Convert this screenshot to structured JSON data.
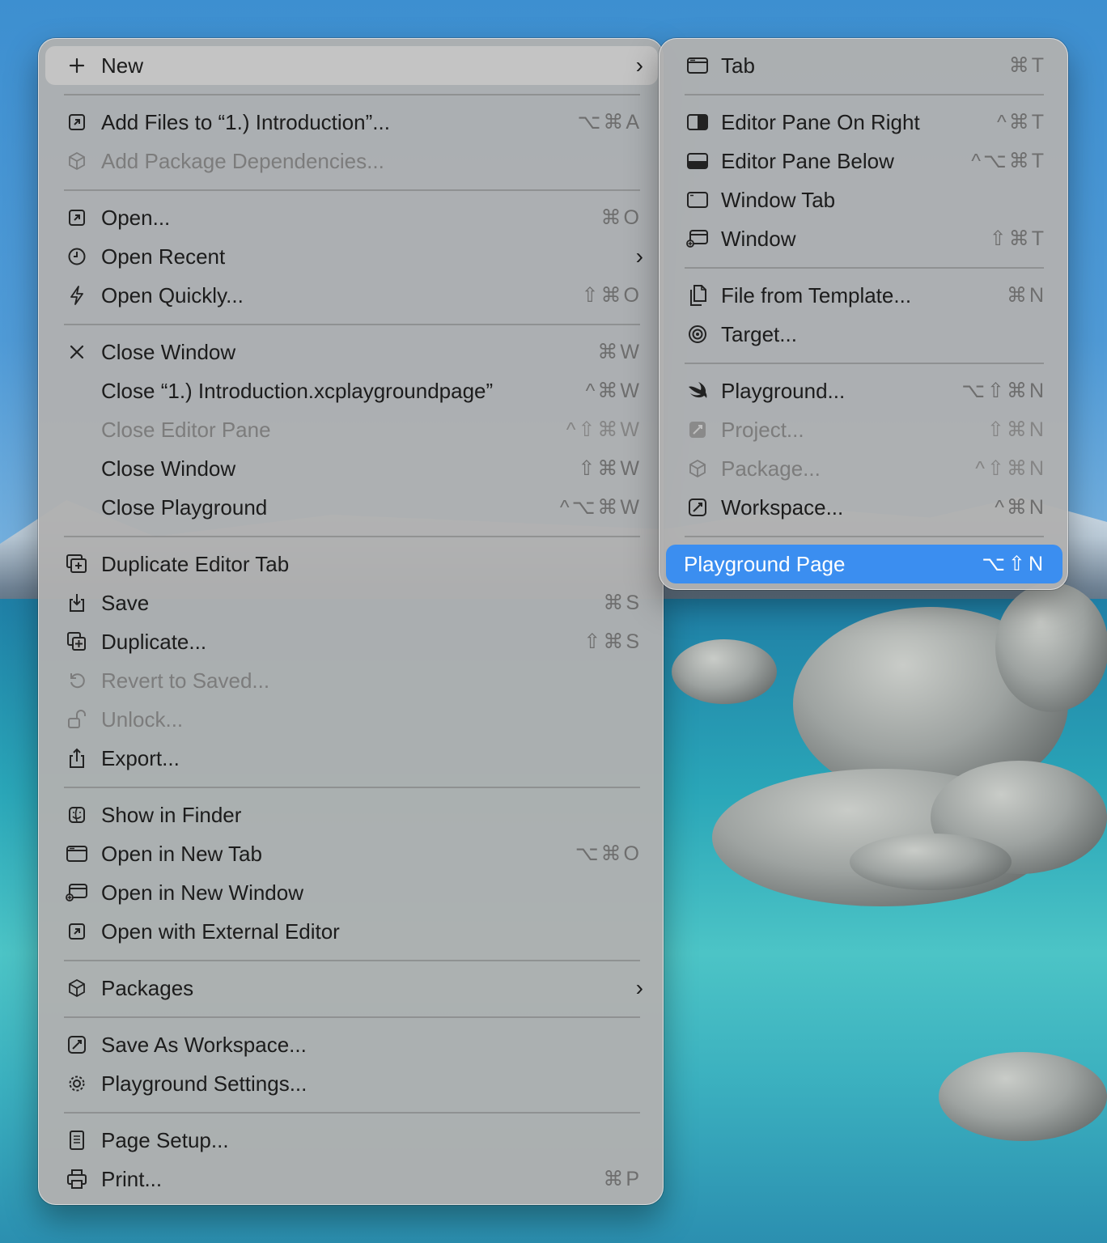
{
  "main_menu": {
    "items": [
      {
        "label": "New",
        "icon": "plus-icon",
        "submenu": true
      },
      {
        "label": "Add Files to “1.) Introduction”...",
        "icon": "add-file-icon",
        "shortcut": "⌥⌘A"
      },
      {
        "label": "Add Package Dependencies...",
        "icon": "package-icon",
        "disabled": true
      },
      {
        "label": "Open...",
        "icon": "open-icon",
        "shortcut": "⌘O"
      },
      {
        "label": "Open Recent",
        "icon": "clock-icon",
        "submenu": true
      },
      {
        "label": "Open Quickly...",
        "icon": "bolt-icon",
        "shortcut": "⇧⌘O"
      },
      {
        "label": "Close Window",
        "icon": "close-icon",
        "shortcut": "⌘W"
      },
      {
        "label": "Close “1.) Introduction.xcplaygroundpage”",
        "shortcut": "^⌘W"
      },
      {
        "label": "Close Editor Pane",
        "shortcut": "^⇧⌘W",
        "disabled": true
      },
      {
        "label": "Close Window",
        "shortcut": "⇧⌘W"
      },
      {
        "label": "Close Playground",
        "shortcut": "^⌥⌘W"
      },
      {
        "label": "Duplicate Editor Tab",
        "icon": "duplicate-tab-icon"
      },
      {
        "label": "Save",
        "icon": "save-icon",
        "shortcut": "⌘S"
      },
      {
        "label": "Duplicate...",
        "icon": "duplicate-icon",
        "shortcut": "⇧⌘S"
      },
      {
        "label": "Revert to Saved...",
        "icon": "revert-icon",
        "disabled": true
      },
      {
        "label": "Unlock...",
        "icon": "unlock-icon",
        "disabled": true
      },
      {
        "label": "Export...",
        "icon": "export-icon"
      },
      {
        "label": "Show in Finder",
        "icon": "finder-icon"
      },
      {
        "label": "Open in New Tab",
        "icon": "tab-icon",
        "shortcut": "⌥⌘O"
      },
      {
        "label": "Open in New Window",
        "icon": "new-window-icon"
      },
      {
        "label": "Open with External Editor",
        "icon": "external-editor-icon"
      },
      {
        "label": "Packages",
        "icon": "package-icon",
        "submenu": true
      },
      {
        "label": "Save As Workspace...",
        "icon": "workspace-icon"
      },
      {
        "label": "Playground Settings...",
        "icon": "gear-icon"
      },
      {
        "label": "Page Setup...",
        "icon": "page-setup-icon"
      },
      {
        "label": "Print...",
        "icon": "printer-icon",
        "shortcut": "⌘P"
      }
    ],
    "chevron": "›"
  },
  "sub_menu": {
    "items": [
      {
        "label": "Tab",
        "icon": "tab-icon",
        "shortcut": "⌘T"
      },
      {
        "label": "Editor Pane On Right",
        "icon": "pane-right-icon",
        "shortcut": "^⌘T"
      },
      {
        "label": "Editor Pane Below",
        "icon": "pane-below-icon",
        "shortcut": "^⌥⌘T"
      },
      {
        "label": "Window Tab",
        "icon": "window-tab-icon"
      },
      {
        "label": "Window",
        "icon": "new-window-icon",
        "shortcut": "⇧⌘T"
      },
      {
        "label": "File from Template...",
        "icon": "file-template-icon",
        "shortcut": "⌘N"
      },
      {
        "label": "Target...",
        "icon": "target-icon"
      },
      {
        "label": "Playground...",
        "icon": "swift-icon",
        "shortcut": "⌥⇧⌘N"
      },
      {
        "label": "Project...",
        "icon": "project-icon",
        "shortcut": "⇧⌘N",
        "disabled": true
      },
      {
        "label": "Package...",
        "icon": "package-icon",
        "shortcut": "^⇧⌘N",
        "disabled": true
      },
      {
        "label": "Workspace...",
        "icon": "workspace-icon",
        "shortcut": "^⌘N"
      },
      {
        "label": "Playground Page",
        "shortcut": "⌥⇧N",
        "selected": true
      }
    ]
  },
  "colors": {
    "highlight": "#3b8ef0",
    "menu_bg": "#b0b0b0"
  }
}
